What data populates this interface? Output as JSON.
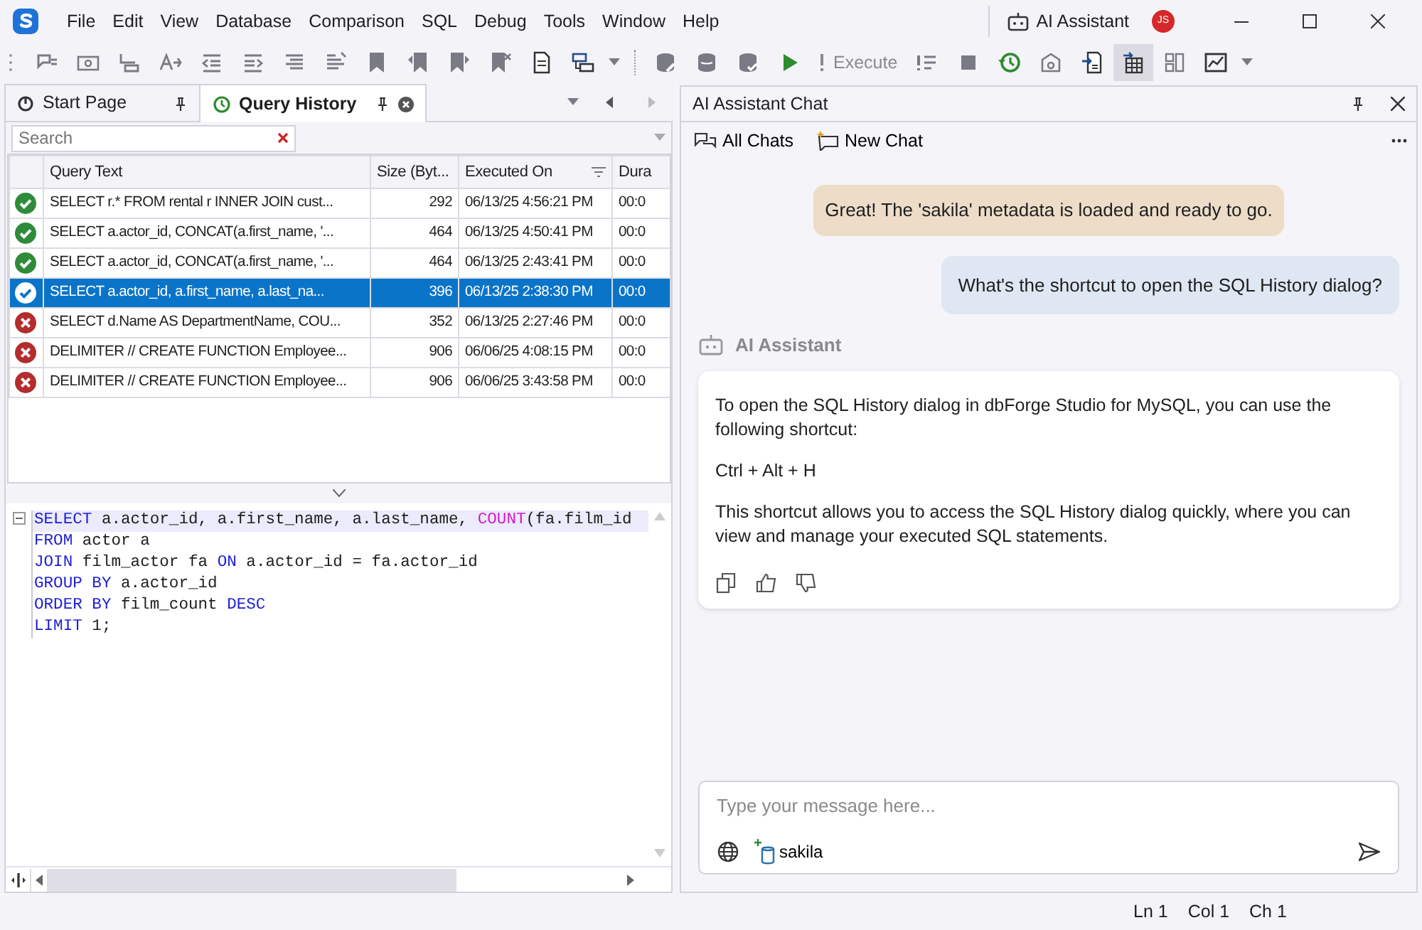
{
  "menu": [
    {
      "label": "File"
    },
    {
      "label": "Edit"
    },
    {
      "label": "View"
    },
    {
      "label": "Database"
    },
    {
      "label": "Comparison"
    },
    {
      "label": "SQL"
    },
    {
      "label": "Debug"
    },
    {
      "label": "Tools"
    },
    {
      "label": "Window"
    },
    {
      "label": "Help"
    }
  ],
  "title_bar": {
    "assistant_label": "AI Assistant",
    "user_initials": "JS"
  },
  "toolbar": {
    "buttons": [
      {
        "kind": "icon",
        "pressed": false
      },
      {
        "kind": "icon",
        "pressed": false
      },
      {
        "kind": "icon",
        "pressed": false
      },
      {
        "kind": "icon",
        "pressed": false
      },
      {
        "kind": "icon",
        "pressed": false
      },
      {
        "kind": "icon",
        "pressed": false
      },
      {
        "kind": "icon",
        "pressed": false
      },
      {
        "kind": "icon",
        "pressed": false
      },
      {
        "kind": "icon",
        "pressed": false
      },
      {
        "kind": "icon",
        "pressed": false
      },
      {
        "kind": "icon",
        "pressed": false
      },
      {
        "kind": "icon",
        "pressed": false
      },
      {
        "kind": "icon",
        "pressed": false
      },
      {
        "kind": "icon",
        "pressed": false
      },
      {
        "kind": "separator"
      },
      {
        "kind": "icon",
        "pressed": false
      },
      {
        "kind": "icon",
        "pressed": false
      },
      {
        "kind": "icon",
        "pressed": false
      },
      {
        "kind": "icon",
        "pressed": false
      },
      {
        "kind": "labeled",
        "label": "Execute",
        "disabled": true
      },
      {
        "kind": "icon",
        "pressed": false
      },
      {
        "kind": "icon",
        "pressed": false
      },
      {
        "kind": "icon",
        "pressed": false
      },
      {
        "kind": "icon",
        "pressed": false
      },
      {
        "kind": "icon",
        "pressed": false
      },
      {
        "kind": "icon",
        "pressed": true
      },
      {
        "kind": "icon",
        "pressed": false
      },
      {
        "kind": "icon",
        "pressed": false
      }
    ]
  },
  "document_tabs": [
    {
      "label": "Start Page",
      "selected": false
    },
    {
      "label": "Query History",
      "selected": true
    }
  ],
  "history": {
    "search": {
      "placeholder": "Search"
    },
    "columns": [
      "Query Text",
      "Size (Byt...",
      "Executed On",
      "Dura"
    ],
    "rows": [
      {
        "succeeded": true,
        "query": "SELECT r.* FROM rental r INNER JOIN cust...",
        "size": "292",
        "executed_on": "06/13/25 4:56:21 PM",
        "duration": "00:0",
        "selected": false
      },
      {
        "succeeded": true,
        "query": "SELECT a.actor_id, CONCAT(a.first_name, '...",
        "size": "464",
        "executed_on": "06/13/25 4:50:41 PM",
        "duration": "00:0",
        "selected": false
      },
      {
        "succeeded": true,
        "query": "SELECT a.actor_id, CONCAT(a.first_name, '...",
        "size": "464",
        "executed_on": "06/13/25 2:43:41 PM",
        "duration": "00:0",
        "selected": false
      },
      {
        "succeeded": true,
        "query": "SELECT a.actor_id, a.first_name, a.last_na...",
        "size": "396",
        "executed_on": "06/13/25 2:38:30 PM",
        "duration": "00:0",
        "selected": true
      },
      {
        "succeeded": false,
        "query": "SELECT d.Name AS DepartmentName, COU...",
        "size": "352",
        "executed_on": "06/13/25 2:27:46 PM",
        "duration": "00:0",
        "selected": false
      },
      {
        "succeeded": false,
        "query": "DELIMITER // CREATE FUNCTION Employee...",
        "size": "906",
        "executed_on": "06/06/25 4:08:15 PM",
        "duration": "00:0",
        "selected": false
      },
      {
        "succeeded": false,
        "query": "DELIMITER // CREATE FUNCTION Employee...",
        "size": "906",
        "executed_on": "06/06/25 3:43:58 PM",
        "duration": "00:0",
        "selected": false
      }
    ]
  },
  "editor": {
    "lines": [
      [
        {
          "kind": "keyword",
          "text": "SELECT"
        },
        {
          "kind": "plain",
          "text": " a.actor_id, a.first_name, a.last_name, "
        },
        {
          "kind": "function",
          "text": "COUNT"
        },
        {
          "kind": "plain",
          "text": "(fa.film_id"
        }
      ],
      [
        {
          "kind": "keyword",
          "text": "FROM"
        },
        {
          "kind": "plain",
          "text": " actor a"
        }
      ],
      [
        {
          "kind": "keyword",
          "text": "JOIN"
        },
        {
          "kind": "plain",
          "text": " film_actor fa "
        },
        {
          "kind": "keyword",
          "text": "ON"
        },
        {
          "kind": "plain",
          "text": " a.actor_id = fa.actor_id"
        }
      ],
      [
        {
          "kind": "keyword",
          "text": "GROUP BY"
        },
        {
          "kind": "plain",
          "text": " a.actor_id"
        }
      ],
      [
        {
          "kind": "keyword",
          "text": "ORDER BY"
        },
        {
          "kind": "plain",
          "text": " film_count "
        },
        {
          "kind": "keyword",
          "text": "DESC"
        }
      ],
      [
        {
          "kind": "keyword",
          "text": "LIMIT"
        },
        {
          "kind": "plain",
          "text": " 1;"
        }
      ]
    ]
  },
  "chat": {
    "title": "AI Assistant Chat",
    "actions": [
      {
        "label": "All Chats"
      },
      {
        "label": "New Chat"
      }
    ],
    "messages": [
      {
        "kind": "system",
        "text": "Great! The 'sakila' metadata is loaded and ready to go."
      },
      {
        "kind": "user",
        "text": "What's the shortcut to open the SQL History dialog?"
      },
      {
        "kind": "assistant",
        "sender": "AI Assistant",
        "paragraphs": [
          "To open the SQL History dialog in dbForge Studio for MySQL, you can use the following shortcut:",
          "Ctrl + Alt + H",
          "This shortcut allows you to access the SQL History dialog quickly, where you can view and manage your executed SQL statements."
        ]
      }
    ],
    "input": {
      "placeholder": "Type your message here...",
      "database": "sakila"
    }
  },
  "status_bar": [
    {
      "text": "Ln 1"
    },
    {
      "text": "Col 1"
    },
    {
      "text": "Ch 1"
    }
  ]
}
